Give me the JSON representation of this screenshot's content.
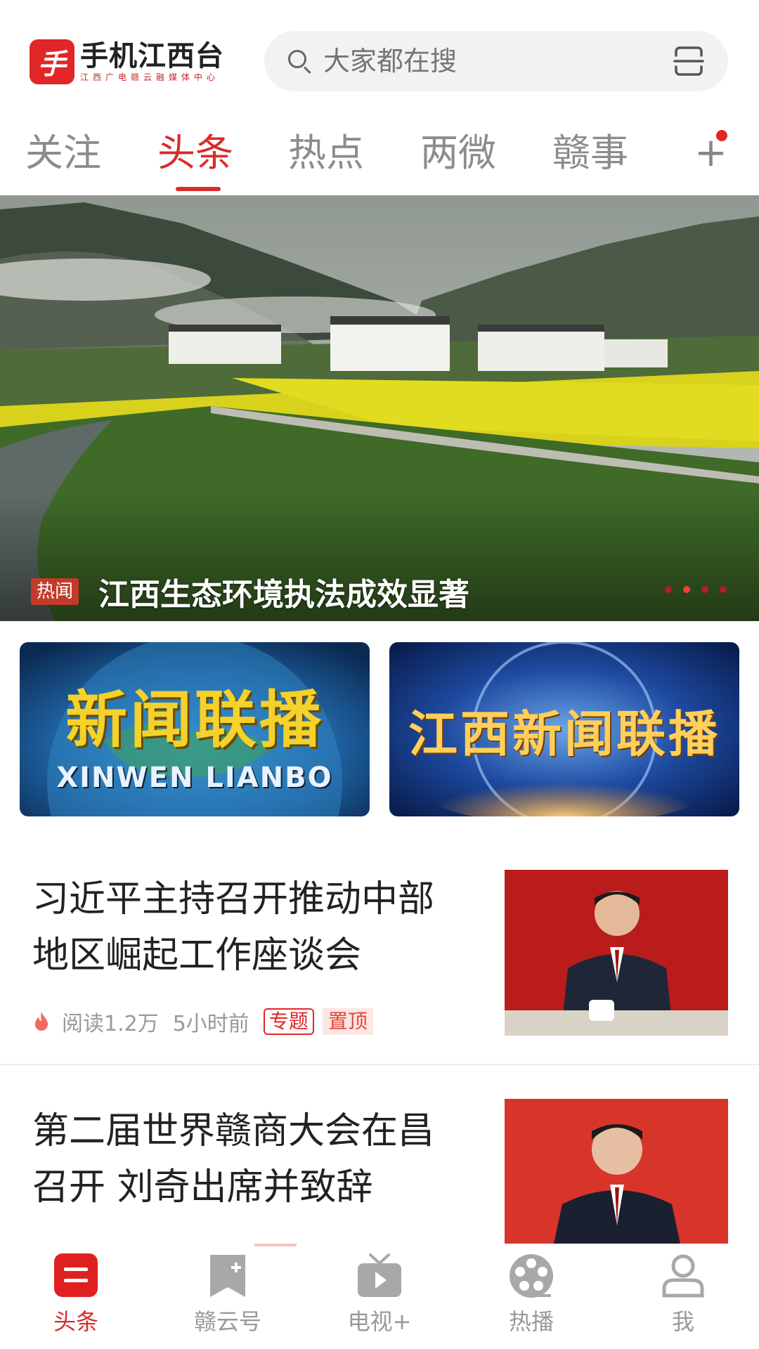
{
  "header": {
    "logo_mark": "手",
    "logo_title": "手机江西台",
    "logo_subtitle": "江西广电赣云融媒体中心",
    "search_placeholder": "大家都在搜"
  },
  "tabs": [
    {
      "label": "关注",
      "active": false
    },
    {
      "label": "头条",
      "active": true
    },
    {
      "label": "热点",
      "active": false
    },
    {
      "label": "两微",
      "active": false
    },
    {
      "label": "赣事",
      "active": false
    }
  ],
  "tab_more": "+",
  "banner": {
    "badge": "热闻",
    "title": "江西生态环境执法成效显著",
    "page_count": 4,
    "active_index": 1
  },
  "programs": [
    {
      "title": "新闻联播",
      "subtitle": "XINWEN LIANBO"
    },
    {
      "title": "江西新闻联播"
    }
  ],
  "news": [
    {
      "title": "习近平主持召开推动中部地区崛起工作座谈会",
      "reads": "阅读1.2万",
      "time": "5小时前",
      "tag_topic": "专题",
      "tag_pin": "置顶"
    },
    {
      "title": "第二届世界赣商大会在昌召开 刘奇出席并致辞"
    }
  ],
  "bottom_nav": [
    {
      "label": "头条",
      "icon": "headline-icon",
      "active": true
    },
    {
      "label": "赣云号",
      "icon": "bookmark-icon",
      "active": false
    },
    {
      "label": "电视+",
      "icon": "tv-icon",
      "active": false
    },
    {
      "label": "热播",
      "icon": "film-reel-icon",
      "active": false
    },
    {
      "label": "我",
      "icon": "profile-icon",
      "active": false
    }
  ],
  "colors": {
    "accent": "#d92b2b",
    "inactive_text": "#8c8c8c"
  }
}
